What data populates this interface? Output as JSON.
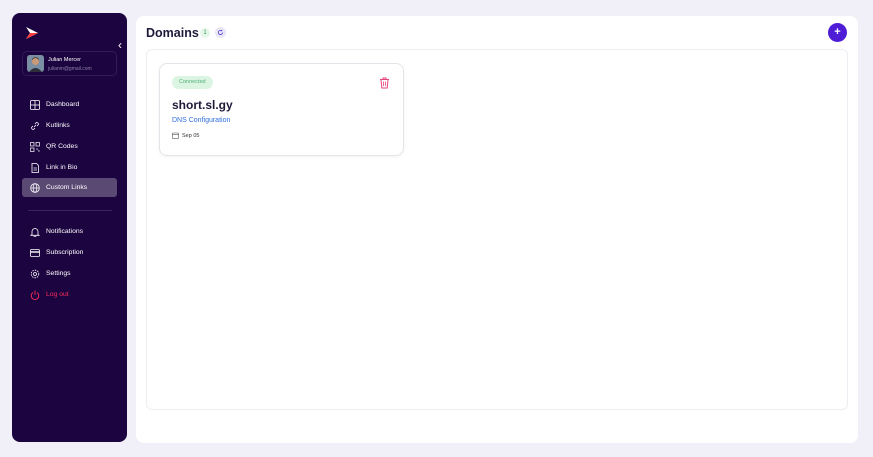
{
  "sidebar": {
    "user": {
      "name": "Julian Mercer",
      "email": "julianm@gmail.com"
    },
    "items": [
      {
        "label": "Dashboard",
        "icon": "dashboard-icon"
      },
      {
        "label": "Kutlinks",
        "icon": "link-icon"
      },
      {
        "label": "QR Codes",
        "icon": "qr-code-icon"
      },
      {
        "label": "Link in Bio",
        "icon": "document-icon"
      },
      {
        "label": "Custom Links",
        "icon": "globe-icon",
        "active": true
      }
    ],
    "secondary_items": [
      {
        "label": "Notifications",
        "icon": "bell-icon"
      },
      {
        "label": "Subscription",
        "icon": "credit-card-icon"
      },
      {
        "label": "Settings",
        "icon": "gear-icon"
      },
      {
        "label": "Log out",
        "icon": "power-icon"
      }
    ]
  },
  "header": {
    "title": "Domains",
    "count": "1"
  },
  "domains": [
    {
      "status": "Connected",
      "name": "short.sl.gy",
      "config_link": "DNS Configuration",
      "date": "Sep 05"
    }
  ],
  "colors": {
    "sidebar_bg": "#1c0440",
    "accent": "#4f1dd6",
    "logout": "#ff2e5b",
    "connected": "#4bb072",
    "link": "#2f6fdc",
    "delete": "#e8457a"
  }
}
